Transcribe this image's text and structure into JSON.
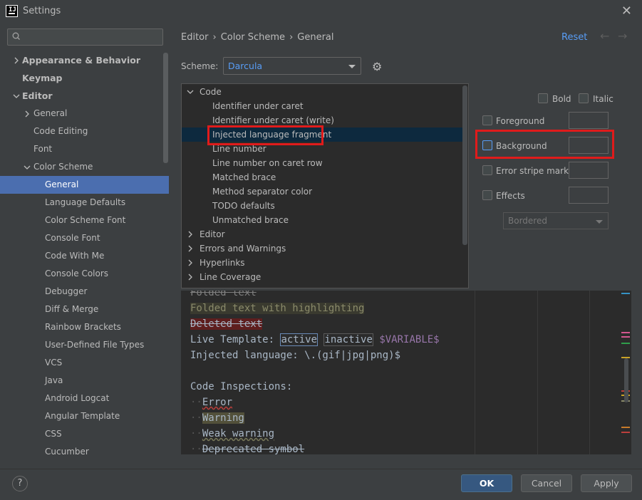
{
  "window": {
    "title": "Settings",
    "app_icon_letter": "IJ"
  },
  "search": {
    "placeholder": ""
  },
  "left_tree": [
    {
      "label": "Appearance & Behavior",
      "level": 0,
      "arrow": "right",
      "bold": true
    },
    {
      "label": "Keymap",
      "level": 0,
      "arrow": "none",
      "bold": true
    },
    {
      "label": "Editor",
      "level": 0,
      "arrow": "down",
      "bold": true
    },
    {
      "label": "General",
      "level": 1,
      "arrow": "right"
    },
    {
      "label": "Code Editing",
      "level": 1,
      "arrow": "none"
    },
    {
      "label": "Font",
      "level": 1,
      "arrow": "none"
    },
    {
      "label": "Color Scheme",
      "level": 1,
      "arrow": "down"
    },
    {
      "label": "General",
      "level": 2,
      "arrow": "none",
      "selected": true
    },
    {
      "label": "Language Defaults",
      "level": 2,
      "arrow": "none"
    },
    {
      "label": "Color Scheme Font",
      "level": 2,
      "arrow": "none"
    },
    {
      "label": "Console Font",
      "level": 2,
      "arrow": "none"
    },
    {
      "label": "Code With Me",
      "level": 2,
      "arrow": "none"
    },
    {
      "label": "Console Colors",
      "level": 2,
      "arrow": "none"
    },
    {
      "label": "Debugger",
      "level": 2,
      "arrow": "none"
    },
    {
      "label": "Diff & Merge",
      "level": 2,
      "arrow": "none"
    },
    {
      "label": "Rainbow Brackets",
      "level": 2,
      "arrow": "none"
    },
    {
      "label": "User-Defined File Types",
      "level": 2,
      "arrow": "none"
    },
    {
      "label": "VCS",
      "level": 2,
      "arrow": "none"
    },
    {
      "label": "Java",
      "level": 2,
      "arrow": "none"
    },
    {
      "label": "Android Logcat",
      "level": 2,
      "arrow": "none"
    },
    {
      "label": "Angular Template",
      "level": 2,
      "arrow": "none"
    },
    {
      "label": "CSS",
      "level": 2,
      "arrow": "none"
    },
    {
      "label": "Cucumber",
      "level": 2,
      "arrow": "none"
    }
  ],
  "breadcrumb": [
    "Editor",
    "Color Scheme",
    "General"
  ],
  "reset_label": "Reset",
  "scheme": {
    "label": "Scheme:",
    "value": "Darcula"
  },
  "attributes_tree": [
    {
      "label": "Code",
      "level": 0,
      "arrow": "down"
    },
    {
      "label": "Identifier under caret",
      "level": 1
    },
    {
      "label": "Identifier under caret (write)",
      "level": 1
    },
    {
      "label": "Injected language fragment",
      "level": 1,
      "selected": true
    },
    {
      "label": "Line number",
      "level": 1
    },
    {
      "label": "Line number on caret row",
      "level": 1
    },
    {
      "label": "Matched brace",
      "level": 1
    },
    {
      "label": "Method separator color",
      "level": 1
    },
    {
      "label": "TODO defaults",
      "level": 1
    },
    {
      "label": "Unmatched brace",
      "level": 1
    },
    {
      "label": "Editor",
      "level": 0,
      "arrow": "right"
    },
    {
      "label": "Errors and Warnings",
      "level": 0,
      "arrow": "right"
    },
    {
      "label": "Hyperlinks",
      "level": 0,
      "arrow": "right"
    },
    {
      "label": "Line Coverage",
      "level": 0,
      "arrow": "right"
    }
  ],
  "options": {
    "bold": "Bold",
    "italic": "Italic",
    "foreground": "Foreground",
    "background": "Background",
    "error_stripe": "Error stripe mark",
    "effects": "Effects",
    "effects_type": "Bordered"
  },
  "preview": {
    "folded_cut": "Folded text",
    "folded_highlight": "Folded text with highlighting",
    "deleted": "Deleted text",
    "live_template_label": "Live Template: ",
    "lt_active": "active",
    "lt_inactive": "inactive",
    "lt_variable": "$VARIABLE$",
    "injected": "Injected language: \\.(gif|jpg|png)$",
    "inspections_header": "Code Inspections:",
    "error": "Error",
    "warning": "Warning",
    "weak_warning": "Weak warning",
    "deprecated": "Deprecated symbol"
  },
  "buttons": {
    "help": "?",
    "ok": "OK",
    "cancel": "Cancel",
    "apply": "Apply"
  },
  "colors": {
    "accent": "#589df6",
    "selection": "#4b6eaf",
    "highlight_border": "#e01b1b"
  }
}
